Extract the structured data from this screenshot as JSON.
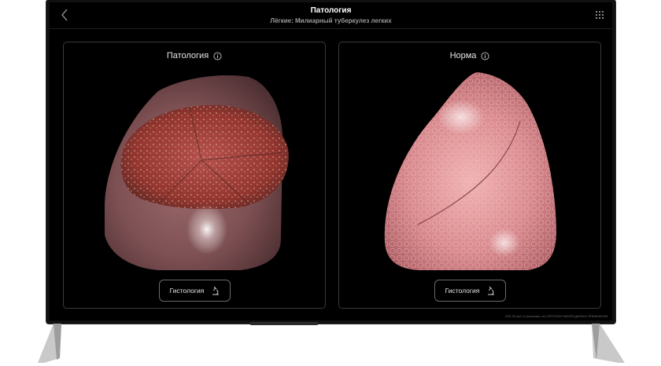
{
  "header": {
    "title": "Патология",
    "subtitle": "Лёгкие: Милиарный туберкулез легких",
    "back_icon": "chevron-left-icon",
    "menu_icon": "grid-dots-icon"
  },
  "panels": [
    {
      "heading": "Патология",
      "button_label": "Гистология",
      "button_icon": "microscope-icon",
      "info_icon": "info-icon",
      "tissue_color": "#8a5a5c",
      "cut_color": "#a5403f"
    },
    {
      "heading": "Норма",
      "button_label": "Гистология",
      "button_icon": "microscope-icon",
      "info_icon": "info-icon",
      "tissue_color": "#d9878b"
    }
  ],
  "footer": {
    "legal": "2021 3D and Co (Анатомия, Ltd.) ПРОТОКОЛ НАБОРА ДАННЫХ ПРИМЕНЕНИЯ"
  }
}
